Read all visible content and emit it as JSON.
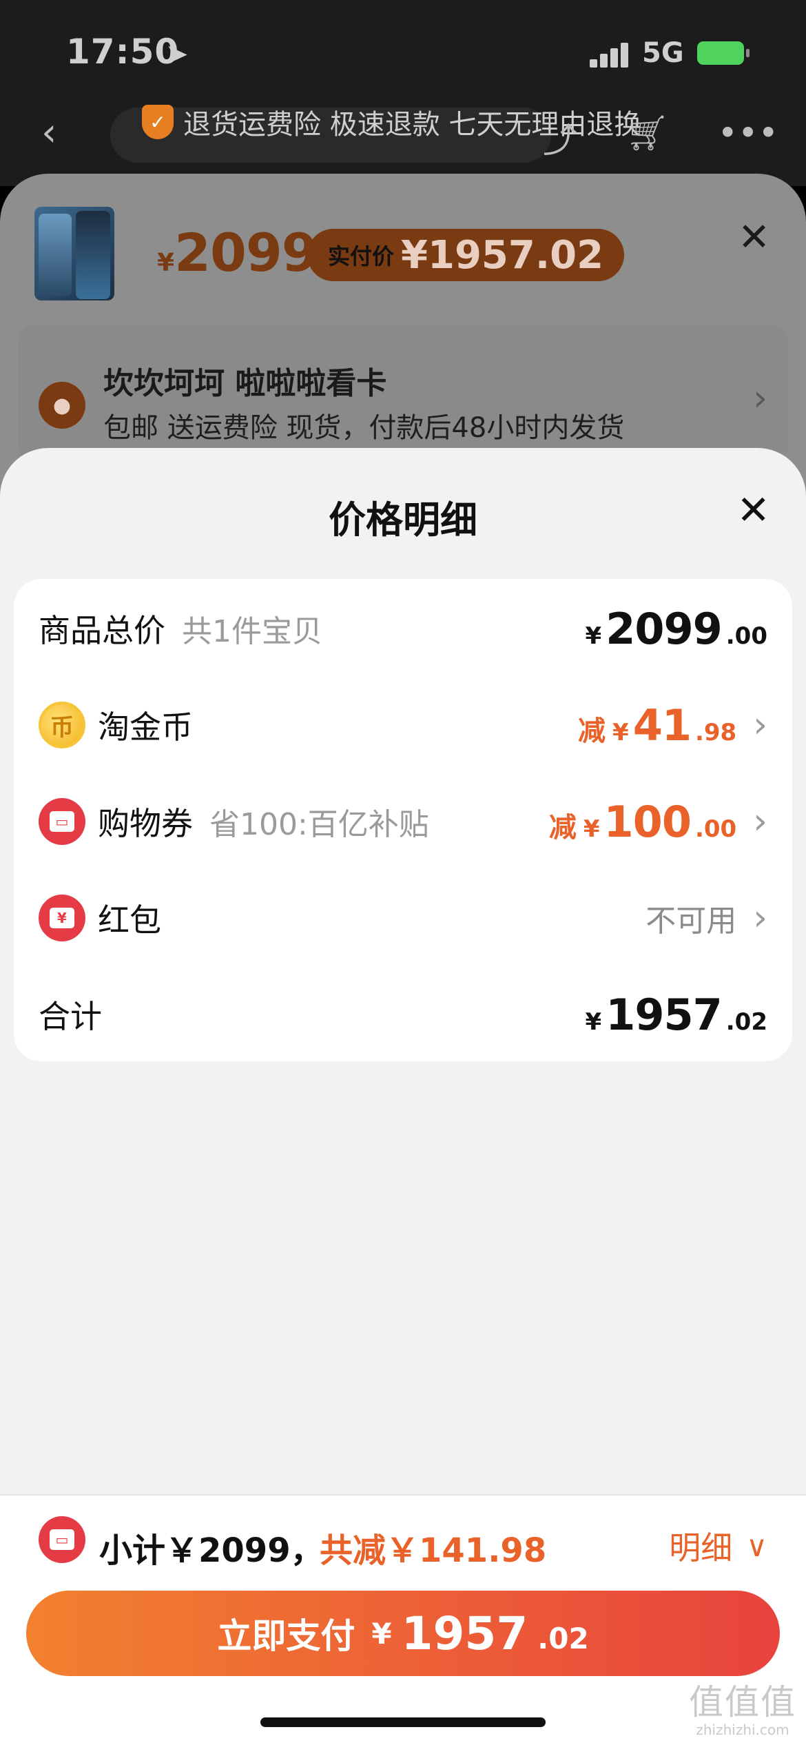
{
  "status_bar": {
    "time": "17:50",
    "location_icon": "location-arrow-icon",
    "network": "5G"
  },
  "nav": {
    "back_icon": "chevron-left-icon",
    "insurance_text": "退货运费险 极速退款 七天无理由退换",
    "icons": [
      "share-icon",
      "cart-icon",
      "more-icon"
    ]
  },
  "product_sheet": {
    "price_symbol": "¥",
    "price": "2099",
    "actual_label": "实付价",
    "actual_price": "¥1957.02",
    "close": "✕",
    "address_name": "坎坎坷坷 啦啦啦看卡",
    "address_desc": "包邮 送运费险 现货，付款后48小时内发货"
  },
  "price_detail": {
    "title": "价格明细",
    "close": "✕",
    "rows": {
      "total": {
        "label": "商品总价",
        "sub": "共1件宝贝",
        "yen": "¥",
        "int": "2099",
        "dec": ".00"
      },
      "coin": {
        "label": "淘金币",
        "minus": "减",
        "yen": "¥",
        "int": "41",
        "dec": ".98",
        "icon": "coin-icon"
      },
      "coupon": {
        "label": "购物券",
        "sub": "省100:百亿补贴",
        "minus": "减",
        "yen": "¥",
        "int": "100",
        "dec": ".00",
        "icon": "coupon-icon"
      },
      "redpack": {
        "label": "红包",
        "value": "不可用",
        "icon": "red-packet-icon"
      },
      "sum": {
        "label": "合计",
        "yen": "¥",
        "int": "1957",
        "dec": ".02"
      }
    }
  },
  "bottom_bar": {
    "subtotal": "小计￥2099，",
    "discount": "共减￥141.98",
    "detail": "明细",
    "pay_label": "立即支付",
    "pay_yen": "¥",
    "pay_int": "1957",
    "pay_dec": ".02"
  },
  "watermark": {
    "line1": "值值值",
    "line2": "zhizhizhi.com"
  },
  "colors": {
    "accent": "#e8622a",
    "red": "#e53b45",
    "pay_start": "#f2812f",
    "pay_end": "#e8433d"
  }
}
